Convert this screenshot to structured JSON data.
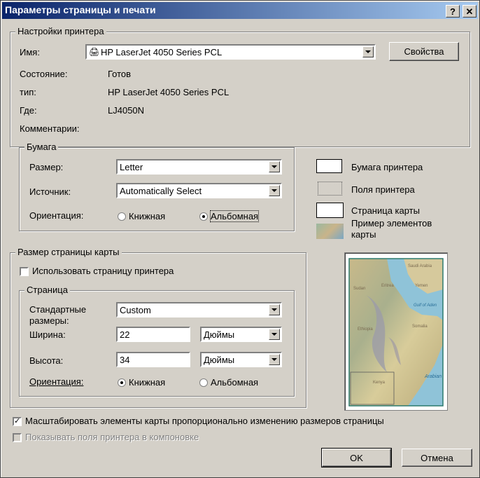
{
  "window": {
    "title": "Параметры страницы и печати",
    "help_label": "?",
    "close_label": "✕"
  },
  "printer": {
    "group_label": "Настройки принтера",
    "name_label": "Имя:",
    "name_value": "HP LaserJet 4050 Series PCL",
    "properties_button": "Свойства",
    "status_label": "Состояние:",
    "status_value": "Готов",
    "type_label": "тип:",
    "type_value": "HP LaserJet 4050 Series PCL",
    "where_label": "Где:",
    "where_value": "LJ4050N",
    "comment_label": "Комментарии:"
  },
  "paper": {
    "group_label": "Бумага",
    "size_label": "Размер:",
    "size_value": "Letter",
    "source_label": "Источник:",
    "source_value": "Automatically Select",
    "orientation_label": "Ориентация:",
    "portrait_label": "Книжная",
    "landscape_label": "Альбомная",
    "selected": "landscape"
  },
  "legend": {
    "printer_paper": "Бумага принтера",
    "printer_margins": "Поля принтера",
    "map_page": "Страница карты",
    "map_elements_line1": "Пример элементов",
    "map_elements_line2": "карты"
  },
  "map_page": {
    "group_label": "Размер страницы карты",
    "use_printer_page": "Использовать страницу принтера",
    "use_printer_page_checked": false,
    "page_group_label": "Страница",
    "standard_sizes_label_line1": "Стандартные",
    "standard_sizes_label_line2": "размеры:",
    "standard_sizes_value": "Custom",
    "width_label": "Ширина:",
    "width_value": "22",
    "width_units": "Дюймы",
    "height_label": "Высота:",
    "height_value": "34",
    "height_units": "Дюймы",
    "orientation_label": "Ориентация:",
    "portrait_label": "Книжная",
    "landscape_label": "Альбомная",
    "selected": "portrait"
  },
  "preview": {
    "place_labels": [
      "Saudi Arabia",
      "Sudan",
      "Eritrea",
      "Yemen",
      "Gulf of Aden",
      "Ethiopia",
      "Somalia",
      "Kenya",
      "Arabian"
    ]
  },
  "options": {
    "scale_elements": "Масштабировать элементы карты пропорционально изменению размеров страницы",
    "scale_elements_checked": true,
    "show_margins": "Показывать поля принтера в компоновке",
    "show_margins_checked": false
  },
  "buttons": {
    "ok": "OK",
    "cancel": "Отмена"
  }
}
